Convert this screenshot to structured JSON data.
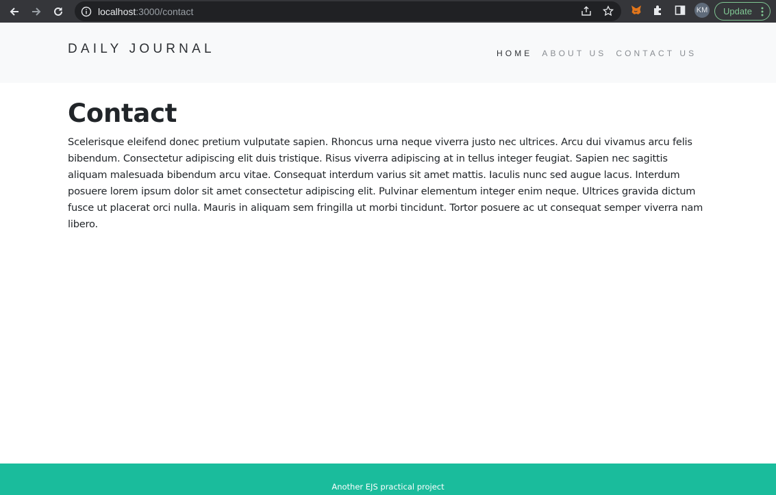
{
  "browser": {
    "url_host": "localhost",
    "url_path": ":3000/contact",
    "profile_initials": "KM",
    "update_label": "Update",
    "icons": [
      "back-icon",
      "forward-icon",
      "reload-icon",
      "info-icon",
      "share-icon",
      "star-icon",
      "metamask-icon",
      "extensions-icon",
      "sidepanel-icon",
      "menu-dots-icon"
    ]
  },
  "site": {
    "brand": "DAILY JOURNAL",
    "nav": {
      "home": "HOME",
      "about": "ABOUT US",
      "contact": "CONTACT US"
    }
  },
  "main": {
    "title": "Contact",
    "body": "Scelerisque eleifend donec pretium vulputate sapien. Rhoncus urna neque viverra justo nec ultrices. Arcu dui vivamus arcu felis bibendum. Consectetur adipiscing elit duis tristique. Risus viverra adipiscing at in tellus integer feugiat. Sapien nec sagittis aliquam malesuada bibendum arcu vitae. Consequat interdum varius sit amet mattis. Iaculis nunc sed augue lacus. Interdum posuere lorem ipsum dolor sit amet consectetur adipiscing elit. Pulvinar elementum integer enim neque. Ultrices gravida dictum fusce ut placerat orci nulla. Mauris in aliquam sem fringilla ut morbi tincidunt. Tortor posuere ac ut consequat semper viverra nam libero."
  },
  "footer": {
    "text": "Another EJS practical project"
  },
  "colors": {
    "footer_bg": "#1abc9c",
    "header_bg": "#f8f9fa",
    "chrome_bg": "#35363a",
    "update_accent": "#81c995"
  }
}
